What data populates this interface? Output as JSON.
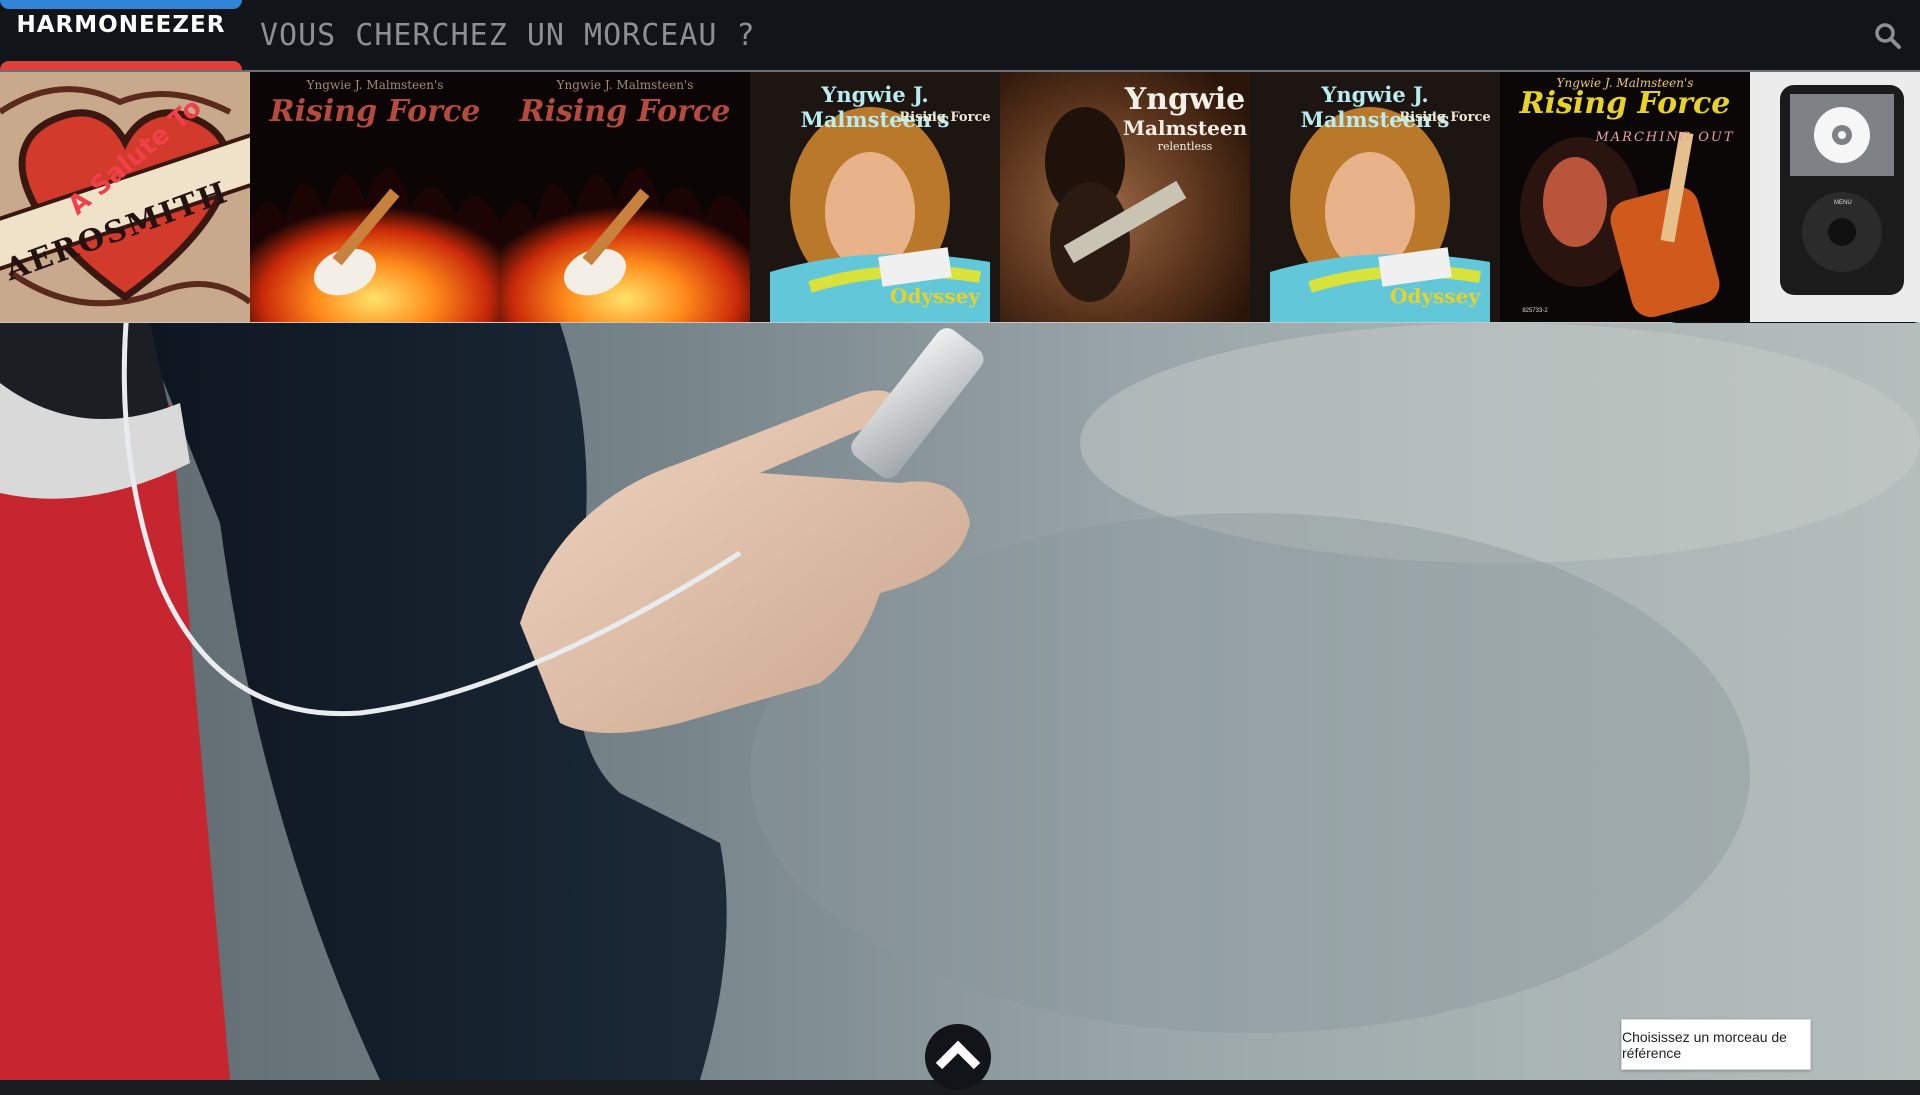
{
  "brand": {
    "name": "HARMONEEZER",
    "top_bar_color": "#2f86d8",
    "bottom_bar_color": "#e0403b"
  },
  "header": {
    "search_prompt": "VOUS CHERCHEZ UN MORCEAU ?",
    "search_icon": "search-icon"
  },
  "albums": [
    {
      "id": "aerosmith",
      "line1": "A Salute To",
      "line2": "AEROSMITH"
    },
    {
      "id": "rising-force-1",
      "line1": "Yngwie J. Malmsteen's",
      "line2": "Rising Force"
    },
    {
      "id": "rising-force-2",
      "line1": "Yngwie J. Malmsteen's",
      "line2": "Rising Force"
    },
    {
      "id": "odyssey-1",
      "line1": "Yngwie J. Malmsteen's",
      "line2": "Rising Force",
      "line3": "Odyssey"
    },
    {
      "id": "relentless",
      "line1": "Yngwie",
      "line2": "Malmsteen",
      "line3": "relentless"
    },
    {
      "id": "odyssey-2",
      "line1": "Yngwie J. Malmsteen's",
      "line2": "Rising Force",
      "line3": "Odyssey"
    },
    {
      "id": "marching-out",
      "line1": "Yngwie J. Malmsteen's",
      "line2": "Rising Force",
      "line3": "MARCHING OUT",
      "catalog": "825733-2"
    },
    {
      "id": "ipod-placeholder",
      "menu_label": "MENU"
    }
  ],
  "controls": {
    "collapse_icon": "double-chevron-up-icon",
    "scroll_up_icon": "chevron-up-icon",
    "reference_button": "Choisissez un morceau de référence"
  },
  "colors": {
    "header_bg": "#111418",
    "accent_blue": "#2f86d8",
    "accent_red": "#e0403b"
  }
}
